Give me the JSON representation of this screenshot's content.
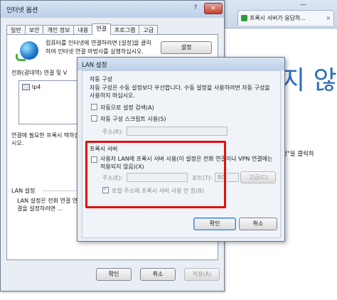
{
  "browser": {
    "tab_label": "프록시 서버가 응답하...",
    "tab_close": "×",
    "minimize": "—",
    "big_text": "지 않",
    "side_text": "정\"을 클릭하"
  },
  "internet_options": {
    "title": "인터넷 옵션",
    "help": "?",
    "close": "×",
    "tabs": [
      "일반",
      "보안",
      "개인 정보",
      "내용",
      "연결",
      "프로그램",
      "고급"
    ],
    "active_tab": "연결",
    "setup_desc": "컴퓨터를 인터넷에 연결하려면 [설정]을 클릭하여 인터넷 연결 마법사를 실행하십시오.",
    "setup_button": "설정",
    "dialup_label": "전화(광대역) 연결 및 V",
    "connection_item": "lp4",
    "proxy_note": "연결에 필요한 프록시 택하십시오.",
    "lan_label": "LAN 설정",
    "lan_desc": "LAN 설정은 전화 연결 연결을 설정하려면 ...",
    "ok": "확인",
    "cancel": "취소",
    "apply": "적용(A)"
  },
  "lan_dialog": {
    "title": "LAN 설정",
    "auto_group": "자동 구성",
    "auto_desc": "자동 구성은 수동 설정보다 우선합니다. 수동 설정을 사용하려면 자동 구성을 사용하지 마십시오.",
    "auto_detect": "자동으로 설정 검색(A)",
    "auto_script": "자동 구성 스크립트 사용(S)",
    "address_label": "주소(R):",
    "proxy_group": "프록시 서버",
    "proxy_use": "사용자 LAN에 프록시 서버 사용(이 설정은 전화 연결이나 VPN 연결에는 적용되지 않음)(X)",
    "proxy_address_label": "주소(E):",
    "proxy_port_label": "포트(T):",
    "proxy_port_value": "80",
    "advanced": "고급(C)",
    "bypass_local": "로컬 주소에 프록시 서버 사용 안 함(B)",
    "ok": "확인",
    "cancel": "취소"
  }
}
